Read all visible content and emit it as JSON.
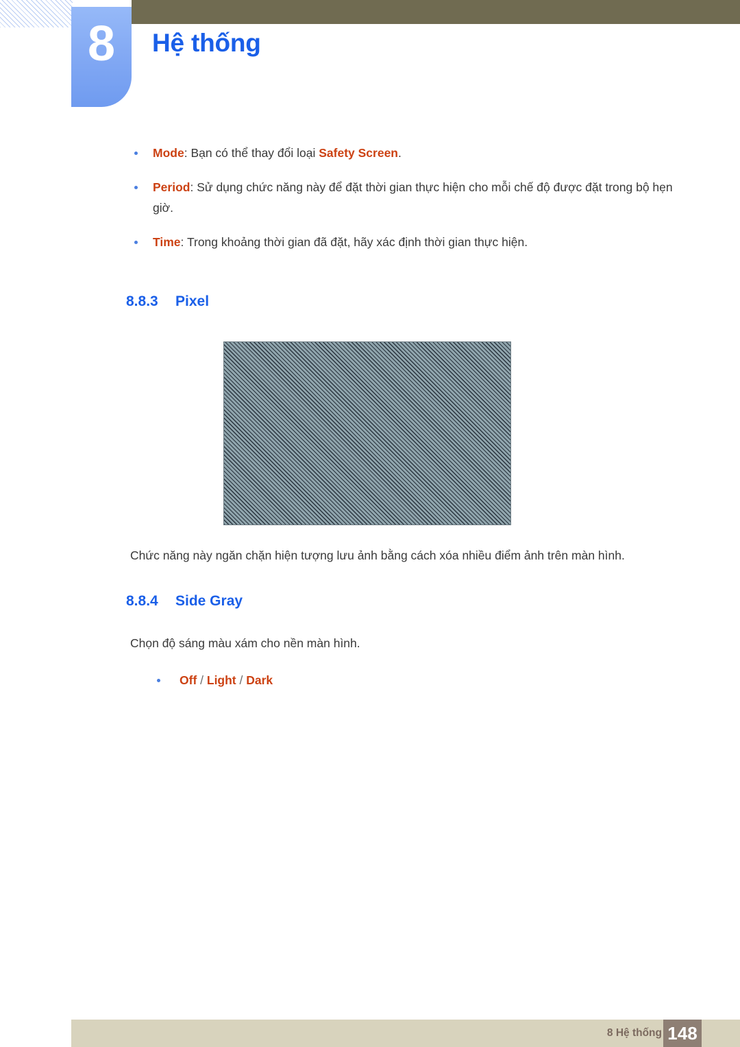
{
  "header": {
    "chapter_number": "8",
    "chapter_title": "Hệ thống",
    "accent_blue": "#1a5fe8",
    "olive_bar_color": "#706b51",
    "badge_gradient_top": "#96b9f8",
    "badge_gradient_bottom": "#6f9bf0"
  },
  "bullets_top": [
    {
      "term": "Mode",
      "colon": ": ",
      "text_before": "Bạn có thể thay đổi loại ",
      "emphasis": "Safety Screen",
      "text_after": "."
    },
    {
      "term": "Period",
      "colon": ": ",
      "text_before": "Sử dụng chức năng này để đặt thời gian thực hiện cho mỗi chế độ được đặt trong bộ hẹn giờ.",
      "emphasis": "",
      "text_after": ""
    },
    {
      "term": "Time",
      "colon": ": ",
      "text_before": "Trong khoảng thời gian đã đặt, hãy xác định thời gian thực hiện.",
      "emphasis": "",
      "text_after": ""
    }
  ],
  "section_pixel": {
    "number": "8.8.3",
    "title": "Pixel",
    "figure_name": "pixel-pattern-image",
    "caption": "Chức năng này ngăn chặn hiện tượng lưu ảnh bằng cách xóa nhiều điểm ảnh trên màn hình.",
    "figure_bg_color": "#8fa4ac",
    "figure_line_color": "#2b3640"
  },
  "section_side_gray": {
    "number": "8.8.4",
    "title": "Side Gray",
    "description": "Chọn độ sáng màu xám cho nền màn hình.",
    "options": {
      "off": "Off",
      "sep1": " / ",
      "light": "Light",
      "sep2": " / ",
      "dark": "Dark"
    }
  },
  "footer": {
    "label": "8 Hệ thống",
    "page_number": "148",
    "bar_color": "#d8d3bd",
    "pagenum_bg": "#8e7f74"
  }
}
